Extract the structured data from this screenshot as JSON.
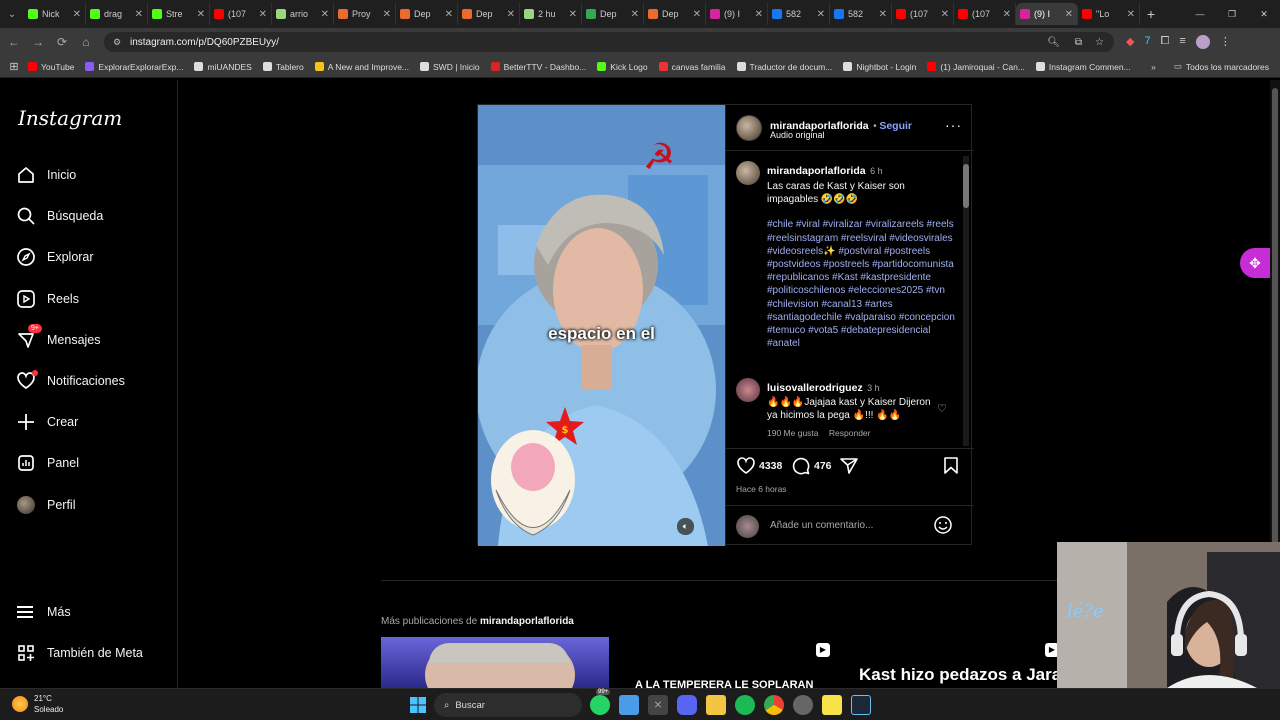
{
  "browser": {
    "tabs": [
      {
        "label": "Nick",
        "color": "#53fc18"
      },
      {
        "label": "drag",
        "color": "#53fc18"
      },
      {
        "label": "Stre",
        "color": "#53fc18"
      },
      {
        "label": "(107",
        "color": "#ff0000"
      },
      {
        "label": "arrio",
        "color": "#9cd67c"
      },
      {
        "label": "Proy",
        "color": "#e96b2d"
      },
      {
        "label": "Dep",
        "color": "#e96b2d"
      },
      {
        "label": "Dep",
        "color": "#e96b2d"
      },
      {
        "label": "2 hu",
        "color": "#9cd67c"
      },
      {
        "label": "Dep",
        "color": "#34a853"
      },
      {
        "label": "Dep",
        "color": "#e96b2d"
      },
      {
        "label": "(9) I",
        "color": "#d6249f"
      },
      {
        "label": "582",
        "color": "#1877f2"
      },
      {
        "label": "582",
        "color": "#1877f2"
      },
      {
        "label": "(107",
        "color": "#ff0000"
      },
      {
        "label": "(107",
        "color": "#ff0000"
      },
      {
        "label": "(9) I",
        "color": "#d6249f"
      },
      {
        "label": "\"Lo",
        "color": "#ff0000"
      }
    ],
    "active_tab_index": 16,
    "url": "instagram.com/p/DQ60PZBEUyy/",
    "bookmarks": [
      {
        "label": "YouTube",
        "color": "#ff0000"
      },
      {
        "label": "ExplorarExplorarExp...",
        "color": "#8a5cf6"
      },
      {
        "label": "miUANDES",
        "color": "#dddddd"
      },
      {
        "label": "Tablero",
        "color": "#dddddd"
      },
      {
        "label": "A New and Improve...",
        "color": "#f5c518"
      },
      {
        "label": "SWD | Inicio",
        "color": "#dddddd"
      },
      {
        "label": "BetterTTV - Dashbo...",
        "color": "#d22"
      },
      {
        "label": "Kick Logo",
        "color": "#53fc18"
      },
      {
        "label": "canvas familia",
        "color": "#e33"
      },
      {
        "label": "Traductor de docum...",
        "color": "#dddddd"
      },
      {
        "label": "Nightbot - Login",
        "color": "#dddddd"
      },
      {
        "label": "(1) Jamiroquai - Can...",
        "color": "#ff0000"
      },
      {
        "label": "Instagram Commen...",
        "color": "#dddddd"
      }
    ],
    "all_bookmarks": "Todos los marcadores"
  },
  "instagram": {
    "logo": "Instagram",
    "nav": [
      {
        "label": "Inicio",
        "icon": "home-icon"
      },
      {
        "label": "Búsqueda",
        "icon": "search-icon"
      },
      {
        "label": "Explorar",
        "icon": "compass-icon"
      },
      {
        "label": "Reels",
        "icon": "reels-icon"
      },
      {
        "label": "Mensajes",
        "icon": "messenger-icon",
        "badge": "9+"
      },
      {
        "label": "Notificaciones",
        "icon": "heart-icon",
        "dot": true
      },
      {
        "label": "Crear",
        "icon": "plus-icon"
      },
      {
        "label": "Panel",
        "icon": "dashboard-icon"
      },
      {
        "label": "Perfil",
        "icon": "avatar-icon"
      }
    ],
    "more": "Más",
    "meta": "También de Meta",
    "post": {
      "username": "mirandaporlaflorida",
      "follow": "Seguir",
      "audio": "Audio original",
      "caption_user": "mirandaporlaflorida",
      "caption_time": "6 h",
      "caption_text": "Las caras de Kast y Kaiser son impagables 🤣🤣🤣",
      "hashtags": "#chile #viral #viralizar #viralizareels #reels #reelsinstagram #reelsviral #videosvirales #videosreels✨ #postviral #postreels #postvideos #postreels #partidocomunista #republicanos #Kast #kastpresidente #politicoschilenos #elecciones2025 #tvn #chilevision #canal13  #artes #santiagodechile #valparaiso #concepcion #temuco #vota5 #debatepresidencial #anatel",
      "comment_user": "luisovallerodriguez",
      "comment_time": "3 h",
      "comment_text": "🔥🔥🔥Jajajaa kast y Kaiser Dijeron ya hicimos la pega 🔥!!! 🔥🔥",
      "comment_likes": "190 Me gusta",
      "reply": "Responder",
      "likes": "4338",
      "comments": "476",
      "posted": "Hace 6 horas",
      "add_comment": "Añade un comentario...",
      "subtitle": "espacio en el"
    },
    "more_posts_prefix": "Más publicaciones de ",
    "more_posts_user": "mirandaporlaflorida",
    "thumb_text_1": "A LA TEMPERERA LE SOPLARAN",
    "thumb_text_2": "Kast hizo pedazos a Jara"
  },
  "taskbar": {
    "weather_temp": "21°C",
    "weather_desc": "Soleado",
    "search": "Buscar",
    "notif": "99+"
  }
}
